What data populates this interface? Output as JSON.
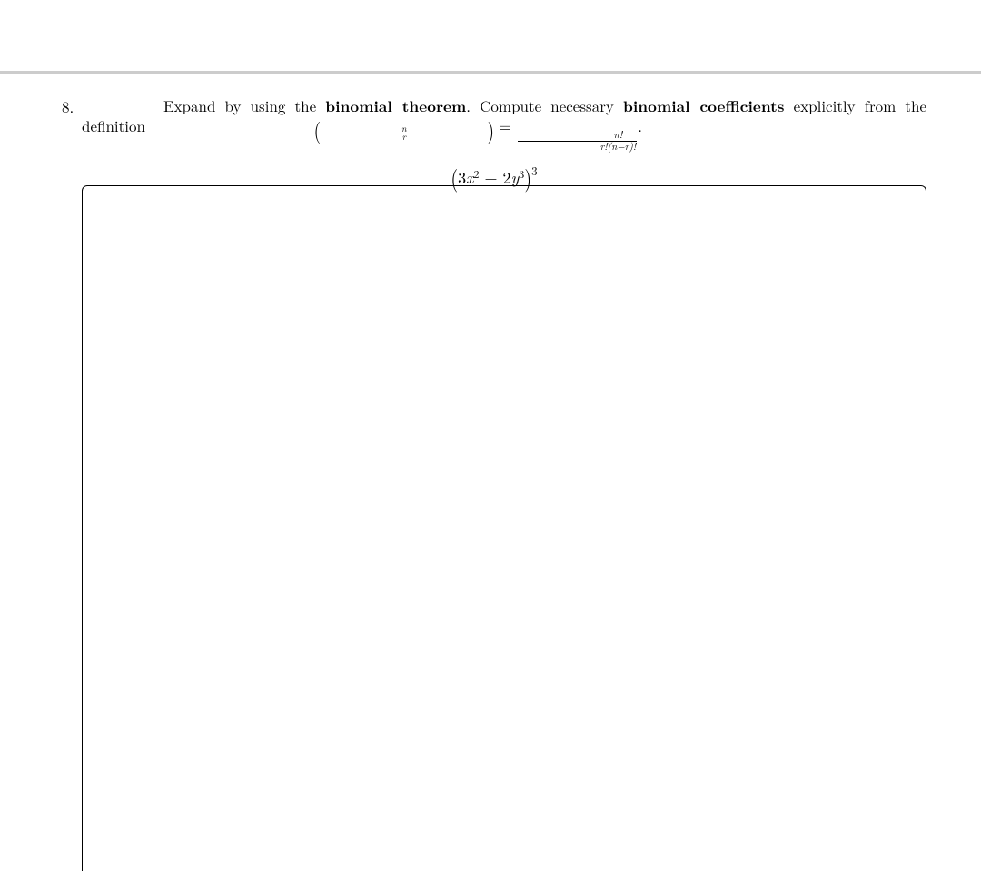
{
  "problem": {
    "number": "8.",
    "prompt_parts": {
      "p1": "Expand by using the ",
      "b1": "binomial theorem",
      "p2": ". Compute necessary ",
      "b2": "binomial coefficients",
      "p3": " explicitly from the definition ",
      "binom_top": "n",
      "binom_bottom": "r",
      "eq": " = ",
      "frac_num": "n!",
      "frac_den": "r!(n−r)!",
      "period": "."
    },
    "expression": {
      "open": "(",
      "a_coef": "3",
      "a_var": "x",
      "a_pow": "2",
      "minus": " − ",
      "b_coef": "2",
      "b_var": "y",
      "b_pow": "3",
      "close": ")",
      "outer_pow": "3"
    }
  }
}
